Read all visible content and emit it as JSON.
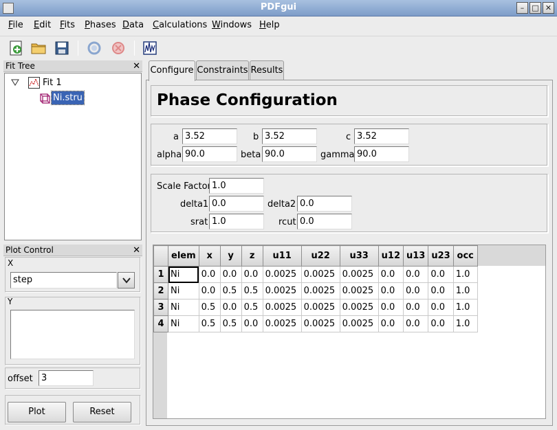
{
  "window": {
    "title": "PDFgui"
  },
  "menu": [
    "File",
    "Edit",
    "Fits",
    "Phases",
    "Data",
    "Calculations",
    "Windows",
    "Help"
  ],
  "toolbar": {
    "icons": [
      "new-fit-icon",
      "open-folder-icon",
      "save-icon",
      "run-icon",
      "stop-icon",
      "plot-icon"
    ]
  },
  "fit_tree": {
    "title": "Fit Tree",
    "items": [
      {
        "label": "Fit 1"
      },
      {
        "label": "Ni.stru",
        "selected": true
      }
    ]
  },
  "plot_control": {
    "title": "Plot Control",
    "x_label": "X",
    "x_value": "step",
    "y_label": "Y",
    "offset_label": "offset",
    "offset_value": "3",
    "plot_button": "Plot",
    "reset_button": "Reset"
  },
  "tabs": [
    "Configure",
    "Constraints",
    "Results"
  ],
  "phase": {
    "heading": "Phase Configuration",
    "lattice": {
      "a_label": "a",
      "a": "3.52",
      "b_label": "b",
      "b": "3.52",
      "c_label": "c",
      "c": "3.52",
      "alpha_label": "alpha",
      "alpha": "90.0",
      "beta_label": "beta",
      "beta": "90.0",
      "gamma_label": "gamma",
      "gamma": "90.0"
    },
    "params": {
      "scale_label": "Scale Factor",
      "scale": "1.0",
      "delta1_label": "delta1",
      "delta1": "0.0",
      "delta2_label": "delta2",
      "delta2": "0.0",
      "srat_label": "srat",
      "srat": "1.0",
      "rcut_label": "rcut",
      "rcut": "0.0"
    },
    "atoms": {
      "columns": [
        "elem",
        "x",
        "y",
        "z",
        "u11",
        "u22",
        "u33",
        "u12",
        "u13",
        "u23",
        "occ"
      ],
      "rows": [
        {
          "index": "1",
          "cells": [
            "Ni",
            "0.0",
            "0.0",
            "0.0",
            "0.0025",
            "0.0025",
            "0.0025",
            "0.0",
            "0.0",
            "0.0",
            "1.0"
          ]
        },
        {
          "index": "2",
          "cells": [
            "Ni",
            "0.0",
            "0.5",
            "0.5",
            "0.0025",
            "0.0025",
            "0.0025",
            "0.0",
            "0.0",
            "0.0",
            "1.0"
          ]
        },
        {
          "index": "3",
          "cells": [
            "Ni",
            "0.5",
            "0.0",
            "0.5",
            "0.0025",
            "0.0025",
            "0.0025",
            "0.0",
            "0.0",
            "0.0",
            "1.0"
          ]
        },
        {
          "index": "4",
          "cells": [
            "Ni",
            "0.5",
            "0.5",
            "0.0",
            "0.0025",
            "0.0025",
            "0.0025",
            "0.0",
            "0.0",
            "0.0",
            "1.0"
          ]
        }
      ]
    }
  }
}
